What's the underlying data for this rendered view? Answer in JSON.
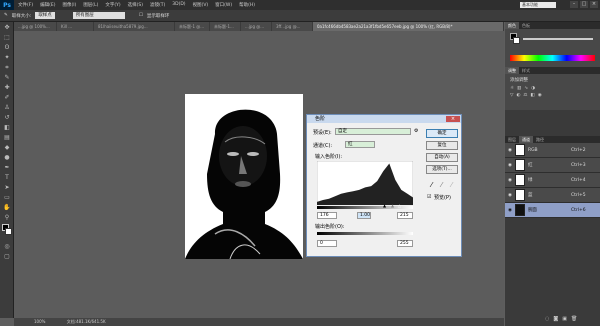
{
  "app": {
    "logo": "Ps",
    "menus": [
      "文件(F)",
      "编辑(E)",
      "图像(I)",
      "图层(L)",
      "文字(Y)",
      "选择(S)",
      "滤镜(T)",
      "3D(D)",
      "视图(V)",
      "窗口(W)",
      "帮助(H)"
    ],
    "workspace": "基本功能"
  },
  "options": {
    "sample_label": "取样大小:",
    "sample_value": "取样点",
    "tolerance_value": "所有图层",
    "show_ring": "显示取样环"
  },
  "tabs": [
    "...jpg @ 100%...",
    "Kill ...",
    "81lhaiiseuitha5879.jpg...",
    "未标题-1 @...",
    "未标题-1...",
    "...jpg @...",
    "3ff...jpg @...",
    "0a1fc466db4583ae2a21a3f1fbd5e657eeb.jpg @ 100% (红, RGB/8)*"
  ],
  "status": {
    "zoom": "100%",
    "doc": "文档:481.1K/641.5K"
  },
  "dialog": {
    "title": "色阶",
    "preset_label": "预设(E):",
    "preset_value": "自定",
    "channel_label": "通道(C):",
    "channel_value": "红",
    "input_label": "输入色阶(I):",
    "input_black": "176",
    "input_gamma": "1.00",
    "input_white": "215",
    "output_label": "输出色阶(O):",
    "output_black": "0",
    "output_white": "255",
    "buttons": [
      "确定",
      "复位",
      "自动(A)",
      "选项(T)..."
    ],
    "preview_label": "预览(P)"
  },
  "panels": {
    "color_tabs": [
      "颜色",
      "色板"
    ],
    "adjust_tabs": [
      "调整",
      "样式"
    ],
    "adjust_title": "添加调整",
    "layer_tabs": [
      "图层",
      "通道",
      "路径"
    ],
    "layers": [
      {
        "name": "RGB",
        "shortcut": "Ctrl+2"
      },
      {
        "name": "红",
        "shortcut": "Ctrl+3"
      },
      {
        "name": "绿",
        "shortcut": "Ctrl+4"
      },
      {
        "name": "蓝",
        "shortcut": "Ctrl+5"
      },
      {
        "name": "腕面",
        "shortcut": "Ctrl+6"
      }
    ]
  },
  "colors": {
    "accent": "#3c7fb1",
    "dialog_bg": "#f0f0f0"
  },
  "chart_data": {
    "type": "area",
    "title": "",
    "xlabel": "",
    "ylabel": "",
    "x": [
      0,
      16,
      32,
      48,
      64,
      80,
      96,
      112,
      128,
      144,
      160,
      176,
      192,
      208,
      224,
      240,
      255
    ],
    "values": [
      5,
      8,
      10,
      14,
      18,
      20,
      22,
      24,
      28,
      30,
      38,
      54,
      66,
      40,
      24,
      18,
      12
    ],
    "ylim": [
      0,
      70
    ]
  }
}
